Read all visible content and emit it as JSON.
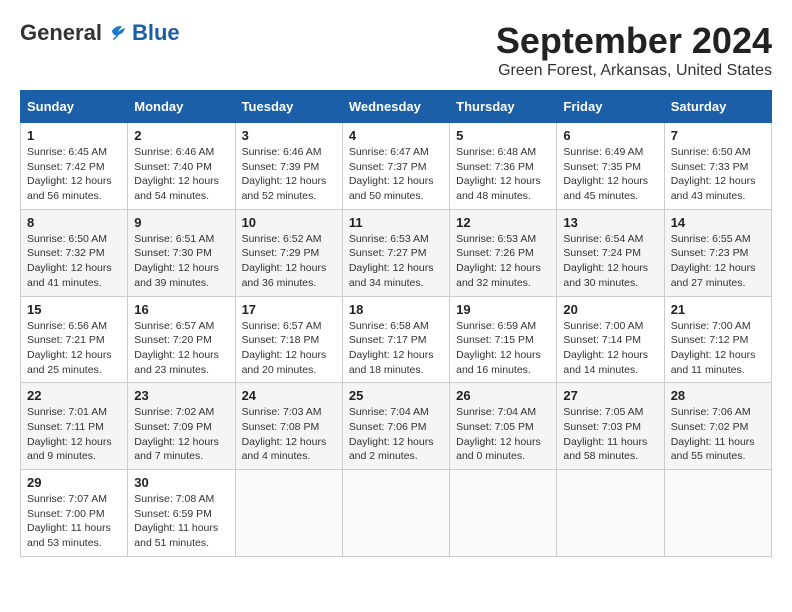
{
  "header": {
    "logo_general": "General",
    "logo_blue": "Blue",
    "title": "September 2024",
    "subtitle": "Green Forest, Arkansas, United States"
  },
  "days_of_week": [
    "Sunday",
    "Monday",
    "Tuesday",
    "Wednesday",
    "Thursday",
    "Friday",
    "Saturday"
  ],
  "weeks": [
    [
      {
        "day": "1",
        "info": "Sunrise: 6:45 AM\nSunset: 7:42 PM\nDaylight: 12 hours\nand 56 minutes."
      },
      {
        "day": "2",
        "info": "Sunrise: 6:46 AM\nSunset: 7:40 PM\nDaylight: 12 hours\nand 54 minutes."
      },
      {
        "day": "3",
        "info": "Sunrise: 6:46 AM\nSunset: 7:39 PM\nDaylight: 12 hours\nand 52 minutes."
      },
      {
        "day": "4",
        "info": "Sunrise: 6:47 AM\nSunset: 7:37 PM\nDaylight: 12 hours\nand 50 minutes."
      },
      {
        "day": "5",
        "info": "Sunrise: 6:48 AM\nSunset: 7:36 PM\nDaylight: 12 hours\nand 48 minutes."
      },
      {
        "day": "6",
        "info": "Sunrise: 6:49 AM\nSunset: 7:35 PM\nDaylight: 12 hours\nand 45 minutes."
      },
      {
        "day": "7",
        "info": "Sunrise: 6:50 AM\nSunset: 7:33 PM\nDaylight: 12 hours\nand 43 minutes."
      }
    ],
    [
      {
        "day": "8",
        "info": "Sunrise: 6:50 AM\nSunset: 7:32 PM\nDaylight: 12 hours\nand 41 minutes."
      },
      {
        "day": "9",
        "info": "Sunrise: 6:51 AM\nSunset: 7:30 PM\nDaylight: 12 hours\nand 39 minutes."
      },
      {
        "day": "10",
        "info": "Sunrise: 6:52 AM\nSunset: 7:29 PM\nDaylight: 12 hours\nand 36 minutes."
      },
      {
        "day": "11",
        "info": "Sunrise: 6:53 AM\nSunset: 7:27 PM\nDaylight: 12 hours\nand 34 minutes."
      },
      {
        "day": "12",
        "info": "Sunrise: 6:53 AM\nSunset: 7:26 PM\nDaylight: 12 hours\nand 32 minutes."
      },
      {
        "day": "13",
        "info": "Sunrise: 6:54 AM\nSunset: 7:24 PM\nDaylight: 12 hours\nand 30 minutes."
      },
      {
        "day": "14",
        "info": "Sunrise: 6:55 AM\nSunset: 7:23 PM\nDaylight: 12 hours\nand 27 minutes."
      }
    ],
    [
      {
        "day": "15",
        "info": "Sunrise: 6:56 AM\nSunset: 7:21 PM\nDaylight: 12 hours\nand 25 minutes."
      },
      {
        "day": "16",
        "info": "Sunrise: 6:57 AM\nSunset: 7:20 PM\nDaylight: 12 hours\nand 23 minutes."
      },
      {
        "day": "17",
        "info": "Sunrise: 6:57 AM\nSunset: 7:18 PM\nDaylight: 12 hours\nand 20 minutes."
      },
      {
        "day": "18",
        "info": "Sunrise: 6:58 AM\nSunset: 7:17 PM\nDaylight: 12 hours\nand 18 minutes."
      },
      {
        "day": "19",
        "info": "Sunrise: 6:59 AM\nSunset: 7:15 PM\nDaylight: 12 hours\nand 16 minutes."
      },
      {
        "day": "20",
        "info": "Sunrise: 7:00 AM\nSunset: 7:14 PM\nDaylight: 12 hours\nand 14 minutes."
      },
      {
        "day": "21",
        "info": "Sunrise: 7:00 AM\nSunset: 7:12 PM\nDaylight: 12 hours\nand 11 minutes."
      }
    ],
    [
      {
        "day": "22",
        "info": "Sunrise: 7:01 AM\nSunset: 7:11 PM\nDaylight: 12 hours\nand 9 minutes."
      },
      {
        "day": "23",
        "info": "Sunrise: 7:02 AM\nSunset: 7:09 PM\nDaylight: 12 hours\nand 7 minutes."
      },
      {
        "day": "24",
        "info": "Sunrise: 7:03 AM\nSunset: 7:08 PM\nDaylight: 12 hours\nand 4 minutes."
      },
      {
        "day": "25",
        "info": "Sunrise: 7:04 AM\nSunset: 7:06 PM\nDaylight: 12 hours\nand 2 minutes."
      },
      {
        "day": "26",
        "info": "Sunrise: 7:04 AM\nSunset: 7:05 PM\nDaylight: 12 hours\nand 0 minutes."
      },
      {
        "day": "27",
        "info": "Sunrise: 7:05 AM\nSunset: 7:03 PM\nDaylight: 11 hours\nand 58 minutes."
      },
      {
        "day": "28",
        "info": "Sunrise: 7:06 AM\nSunset: 7:02 PM\nDaylight: 11 hours\nand 55 minutes."
      }
    ],
    [
      {
        "day": "29",
        "info": "Sunrise: 7:07 AM\nSunset: 7:00 PM\nDaylight: 11 hours\nand 53 minutes."
      },
      {
        "day": "30",
        "info": "Sunrise: 7:08 AM\nSunset: 6:59 PM\nDaylight: 11 hours\nand 51 minutes."
      },
      {
        "day": "",
        "info": ""
      },
      {
        "day": "",
        "info": ""
      },
      {
        "day": "",
        "info": ""
      },
      {
        "day": "",
        "info": ""
      },
      {
        "day": "",
        "info": ""
      }
    ]
  ]
}
